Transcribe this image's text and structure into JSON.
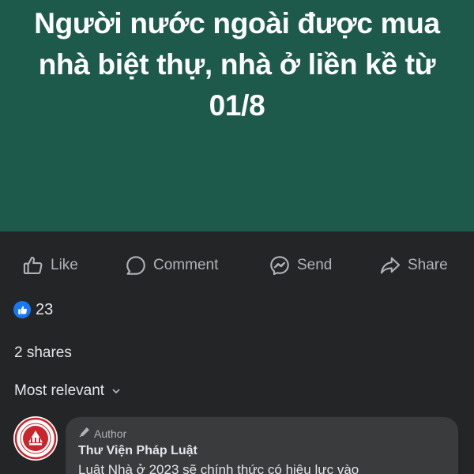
{
  "post": {
    "banner_title": "Người nước ngoài được mua nhà biệt thự, nhà ở liền kề từ 01/8",
    "banner_color": "#1d5a4c"
  },
  "actions": {
    "like": {
      "label": "Like",
      "icon": "thumbs-up-outline-icon"
    },
    "comment": {
      "label": "Comment",
      "icon": "comment-bubble-icon"
    },
    "send": {
      "label": "Send",
      "icon": "messenger-icon"
    },
    "share": {
      "label": "Share",
      "icon": "share-arrow-icon"
    }
  },
  "stats": {
    "reaction_count": "23",
    "reaction_icon": "like-reaction-icon",
    "reaction_color": "#1877f2",
    "shares_text": "2 shares"
  },
  "comments_sort": {
    "label": "Most relevant",
    "icon": "chevron-down-icon"
  },
  "comment": {
    "badge_icon": "pen-icon",
    "badge_label": "Author",
    "author_name": "Thư Viện Pháp Luật",
    "text": "Luật Nhà ở 2023 sẽ chính thức có hiệu lực vào"
  }
}
